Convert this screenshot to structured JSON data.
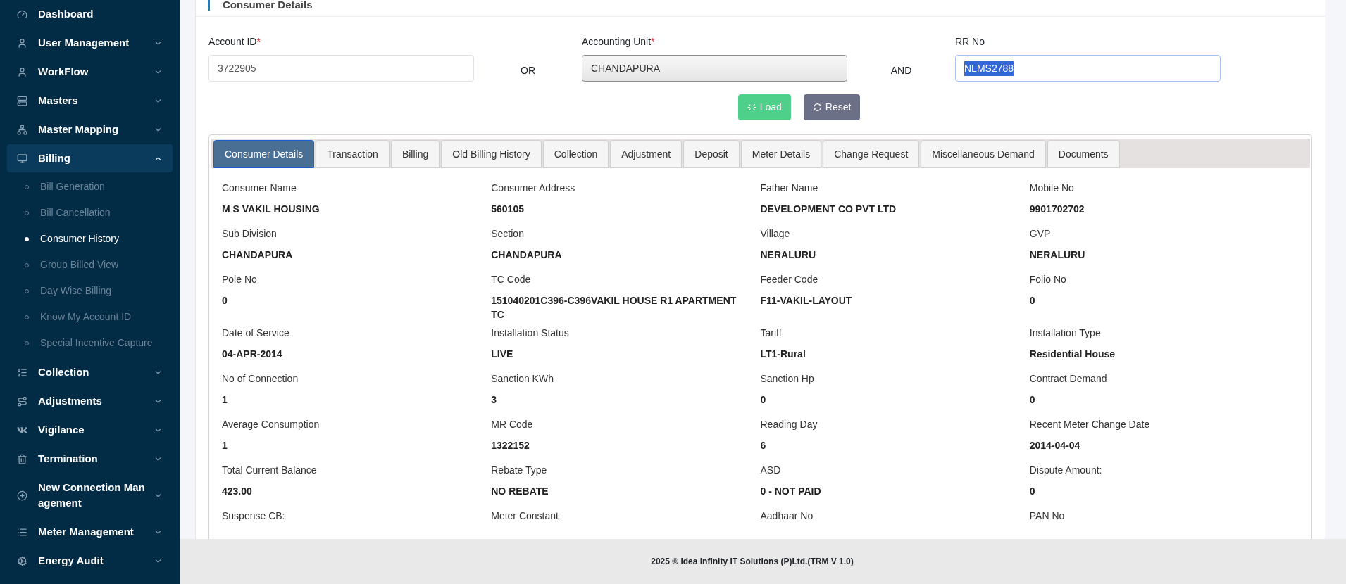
{
  "sidebar": {
    "items": [
      {
        "label": "Dashboard",
        "selected": false
      },
      {
        "label": "User Management",
        "selected": false,
        "expanded": false
      },
      {
        "label": "WorkFlow",
        "selected": false,
        "expanded": false
      },
      {
        "label": "Masters",
        "selected": false,
        "expanded": false
      },
      {
        "label": "Master Mapping",
        "selected": false,
        "expanded": false
      },
      {
        "label": "Billing",
        "selected": true,
        "expanded": true,
        "children": [
          {
            "label": "Bill Generation",
            "selected": false
          },
          {
            "label": "Bill Cancellation",
            "selected": false
          },
          {
            "label": "Consumer History",
            "selected": true
          },
          {
            "label": "Group Billed View",
            "selected": false
          },
          {
            "label": "Day Wise Billing",
            "selected": false
          },
          {
            "label": "Know My Account ID",
            "selected": false
          },
          {
            "label": "Special Incentive Capture",
            "selected": false
          }
        ]
      },
      {
        "label": "Collection",
        "selected": false,
        "expanded": false
      },
      {
        "label": "Adjustments",
        "selected": false,
        "expanded": false
      },
      {
        "label": "Vigilance",
        "selected": false,
        "expanded": false
      },
      {
        "label": "Termination",
        "selected": false,
        "expanded": false
      },
      {
        "label": "New Connection Management",
        "selected": false,
        "expanded": false
      },
      {
        "label": "Meter Management",
        "selected": false,
        "expanded": false
      },
      {
        "label": "Energy Audit",
        "selected": false,
        "expanded": false
      }
    ]
  },
  "card": {
    "title": "Consumer Details",
    "search": {
      "fields": [
        {
          "label": "Account ID",
          "required_mark": "*",
          "value": "3722905",
          "kind": "input"
        },
        {
          "kind": "connector",
          "text": "OR"
        },
        {
          "label": "Accounting Unit",
          "required_mark": "*",
          "value": "CHANDAPURA",
          "kind": "select"
        },
        {
          "kind": "connector",
          "text": "AND"
        },
        {
          "label": "RR No",
          "value": "NLMS2788",
          "kind": "input",
          "value_selected": true
        }
      ],
      "buttons": [
        {
          "label": "Load",
          "kind": "load"
        },
        {
          "label": "Reset",
          "kind": "reset"
        }
      ]
    },
    "tabs": [
      {
        "label": "Consumer Details",
        "selected": true
      },
      {
        "label": "Transaction",
        "selected": false
      },
      {
        "label": "Billing",
        "selected": false
      },
      {
        "label": "Old Billing History",
        "selected": false
      },
      {
        "label": "Collection",
        "selected": false
      },
      {
        "label": "Adjustment",
        "selected": false
      },
      {
        "label": "Deposit",
        "selected": false
      },
      {
        "label": "Meter Details",
        "selected": false
      },
      {
        "label": "Change Request",
        "selected": false
      },
      {
        "label": "Miscellaneous Demand",
        "selected": false
      },
      {
        "label": "Documents",
        "selected": false
      }
    ],
    "details": [
      {
        "label": "Consumer Name",
        "value": "M S VAKIL HOUSING"
      },
      {
        "label": "Consumer Address",
        "value": "560105"
      },
      {
        "label": "Father Name",
        "value": "DEVELOPMENT CO PVT LTD"
      },
      {
        "label": "Mobile No",
        "value": "9901702702"
      },
      {
        "label": "Sub Division",
        "value": "CHANDAPURA"
      },
      {
        "label": "Section",
        "value": "CHANDAPURA"
      },
      {
        "label": "Village",
        "value": "NERALURU"
      },
      {
        "label": "GVP",
        "value": "NERALURU"
      },
      {
        "label": "Pole No",
        "value": "0"
      },
      {
        "label": "TC Code",
        "value": "151040201C396-C396VAKIL HOUSE R1 APARTMENT TC"
      },
      {
        "label": "Feeder Code",
        "value": "F11-VAKIL-LAYOUT"
      },
      {
        "label": "Folio No",
        "value": "0"
      },
      {
        "label": "Date of Service",
        "value": "04-APR-2014"
      },
      {
        "label": "Installation Status",
        "value": "LIVE"
      },
      {
        "label": "Tariff",
        "value": "LT1-Rural"
      },
      {
        "label": "Installation Type",
        "value": "Residential House"
      },
      {
        "label": "No of Connection",
        "value": "1"
      },
      {
        "label": "Sanction KWh",
        "value": "3"
      },
      {
        "label": "Sanction Hp",
        "value": "0"
      },
      {
        "label": "Contract Demand",
        "value": "0"
      },
      {
        "label": "Average Consumption",
        "value": "1"
      },
      {
        "label": "MR Code",
        "value": "1322152"
      },
      {
        "label": "Reading Day",
        "value": "6"
      },
      {
        "label": "Recent Meter Change Date",
        "value": "2014-04-04"
      },
      {
        "label": "Total Current Balance",
        "value": "423.00"
      },
      {
        "label": "Rebate Type",
        "value": "NO REBATE"
      },
      {
        "label": "ASD",
        "value": "0 - NOT PAID"
      },
      {
        "label": "Dispute Amount:",
        "value": "0"
      },
      {
        "label": "Suspense CB:"
      },
      {
        "label": "Meter Constant"
      },
      {
        "label": "Aadhaar No"
      },
      {
        "label": "PAN No"
      }
    ]
  },
  "footer": "2025 © Idea Infinity IT Solutions (P)Ltd.(TRM V 1.0)"
}
